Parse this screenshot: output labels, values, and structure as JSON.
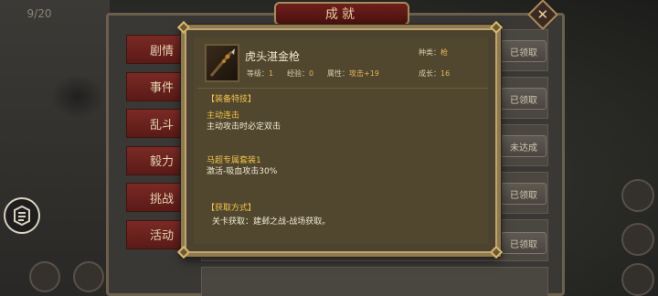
{
  "background": {
    "counter": "9/20",
    "achievement": {
      "title": "成就",
      "close_glyph": "✕",
      "tabs": [
        "剧情",
        "事件",
        "乱斗",
        "毅力",
        "挑战",
        "活动"
      ],
      "rows": [
        {
          "status": "已领取"
        },
        {
          "status": "已领取"
        },
        {
          "status": "未达成"
        },
        {
          "status": "已领取"
        },
        {
          "status": "已领取"
        }
      ]
    }
  },
  "item": {
    "name": "虎头湛金枪",
    "type_label": "种类：",
    "type_value": "枪",
    "level_label": "等级：",
    "level_value": "1",
    "exp_label": "经验：",
    "exp_value": "0",
    "attr_label": "属性：",
    "attr_value": "攻击+19",
    "growth_label": "成长：",
    "growth_value": "16",
    "skills_header": "【装备特技】",
    "skill1_name": "主动连击",
    "skill1_desc": "主动攻击时必定双击",
    "skill2_name": "马超专属套装1",
    "skill2_desc": "激活-吸血攻击30%",
    "source_header": "【获取方式】",
    "source_desc": "关卡获取：建邺之战-战场获取。"
  },
  "colors": {
    "accent_gold": "#f2c24a",
    "value_orange": "#e8b35a",
    "popup_bg": "#51472f",
    "tab_red": "#7a2a25"
  },
  "icons": {
    "item": "spear-icon",
    "left_hud": "scroll-icon",
    "close": "close-icon"
  }
}
